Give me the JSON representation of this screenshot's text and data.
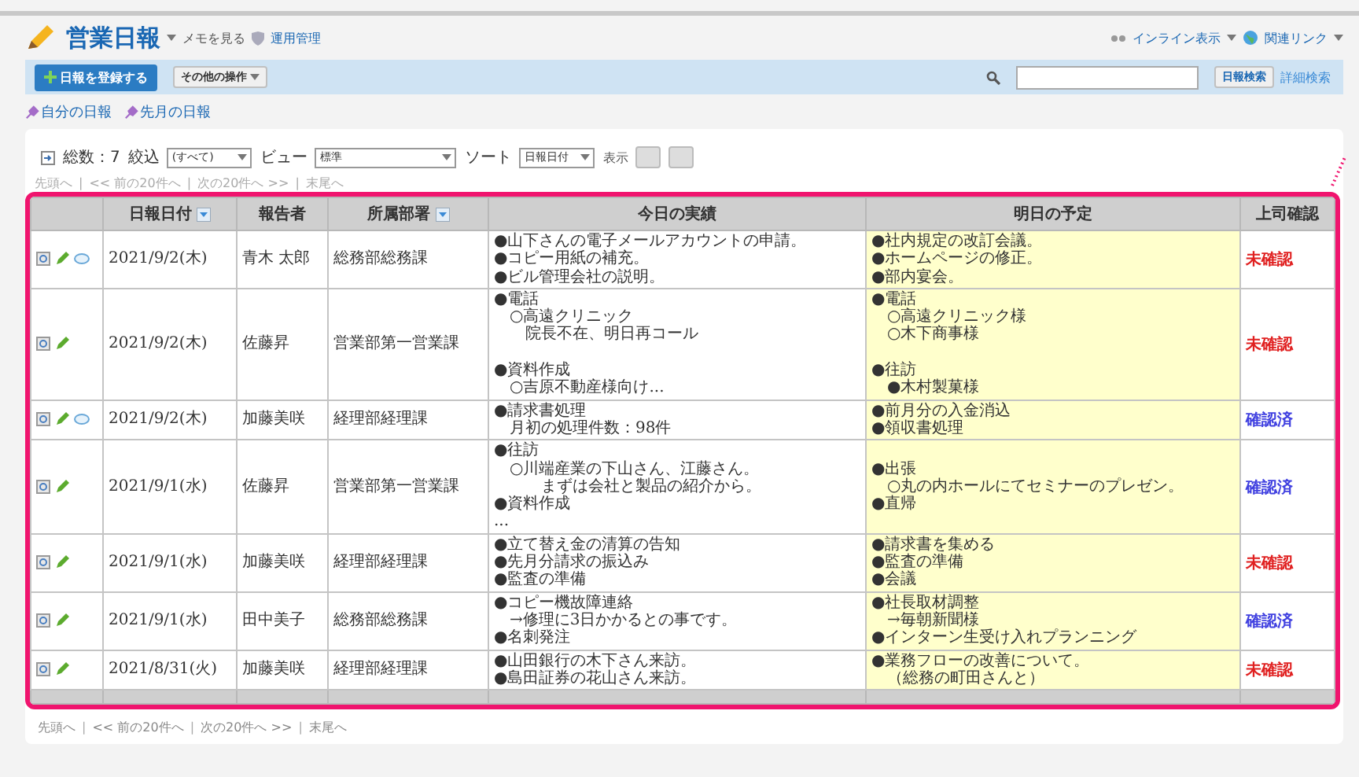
{
  "app": {
    "title": "営業日報",
    "memo_link": "メモを見る",
    "admin_link": "運用管理",
    "inline_view": "インライン表示",
    "related_links": "関連リンク"
  },
  "toolbar": {
    "register_button": "日報を登録する",
    "other_actions": "その他の操作",
    "search_button": "日報検索",
    "advanced_search": "詳細検索"
  },
  "favorites": [
    "自分の日報",
    "先月の日報"
  ],
  "filter_bar": {
    "total": "総数：7",
    "filter_label": "絞込",
    "filter_value": "(すべて)",
    "view_label": "ビュー",
    "view_value": "標準",
    "sort_label": "ソート",
    "sort_value": "日報日付",
    "display_label": "表示"
  },
  "top_pager": {
    "links": [
      "先頭へ",
      "<< 前の20件へ",
      "次の20件へ >>",
      "末尾へ"
    ],
    "separator": "|"
  },
  "table": {
    "columns": [
      {
        "label": "日報日付",
        "sortable": true
      },
      {
        "label": "報告者",
        "sortable": false
      },
      {
        "label": "所属部署",
        "sortable": true
      },
      {
        "label": "今日の実績",
        "sortable": false
      },
      {
        "label": "明日の予定",
        "sortable": false
      },
      {
        "label": "上司確認",
        "sortable": false
      }
    ],
    "rows": [
      {
        "has_comment": true,
        "date": "2021/9/2(木)",
        "reporter": "青木 太郎",
        "department": "総務部総務課",
        "today": [
          [
            "●山下さんの電子メールアカウントの申請。",
            "●コピー用紙の補充。",
            "●ビル管理会社の説明。"
          ]
        ],
        "tomorrow": [
          [
            "●社内規定の改訂会議。",
            "●ホームページの修正。",
            "●部内宴会。"
          ]
        ],
        "status": "未確認",
        "confirmed": false
      },
      {
        "has_comment": false,
        "date": "2021/9/2(木)",
        "reporter": "佐藤昇",
        "department": "営業部第一営業課",
        "today": [
          [
            "●電話",
            "　○高遠クリニック",
            "　　院長不在、明日再コール"
          ],
          [
            "●資料作成",
            "　○吉原不動産様向け..."
          ]
        ],
        "tomorrow": [
          [
            "●電話",
            "　○高遠クリニック様",
            "　○木下商事様"
          ],
          [
            "●往訪",
            "　●木村製菓様"
          ]
        ],
        "status": "未確認",
        "confirmed": false
      },
      {
        "has_comment": true,
        "date": "2021/9/2(木)",
        "reporter": "加藤美咲",
        "department": "経理部経理課",
        "today": [
          [
            "●請求書処理",
            "　月初の処理件数：98件"
          ]
        ],
        "tomorrow": [
          [
            "●前月分の入金消込",
            "●領収書処理"
          ]
        ],
        "status": "確認済",
        "confirmed": true
      },
      {
        "has_comment": false,
        "date": "2021/9/1(水)",
        "reporter": "佐藤昇",
        "department": "営業部第一営業課",
        "today": [
          [
            "●往訪",
            "　○川端産業の下山さん、江藤さん。",
            "　　　まずは会社と製品の紹介から。",
            "●資料作成",
            "..."
          ]
        ],
        "tomorrow": [
          [
            "●出張",
            "　○丸の内ホールにてセミナーのプレゼン。",
            "●直帰"
          ]
        ],
        "status": "確認済",
        "confirmed": true
      },
      {
        "has_comment": false,
        "date": "2021/9/1(水)",
        "reporter": "加藤美咲",
        "department": "経理部経理課",
        "today": [
          [
            "●立て替え金の清算の告知",
            "●先月分請求の振込み",
            "●監査の準備"
          ]
        ],
        "tomorrow": [
          [
            "●請求書を集める",
            "●監査の準備",
            "●会議"
          ]
        ],
        "status": "未確認",
        "confirmed": false
      },
      {
        "has_comment": false,
        "date": "2021/9/1(水)",
        "reporter": "田中美子",
        "department": "総務部総務課",
        "today": [
          [
            "●コピー機故障連絡",
            "　→修理に3日かかるとの事です。",
            "●名刺発注"
          ]
        ],
        "tomorrow": [
          [
            "●社長取材調整",
            "　→毎朝新聞様",
            "●インターン生受け入れプランニング"
          ]
        ],
        "status": "確認済",
        "confirmed": true
      },
      {
        "has_comment": false,
        "date": "2021/8/31(火)",
        "reporter": "加藤美咲",
        "department": "経理部経理課",
        "today": [
          [
            "●山田銀行の木下さん来訪。",
            "●島田証券の花山さん来訪。"
          ]
        ],
        "tomorrow": [
          [
            "●業務フローの改善について。",
            "　（総務の町田さんと）"
          ]
        ],
        "status": "未確認",
        "confirmed": false
      }
    ]
  },
  "bottom_pager": {
    "links": [
      "先頭へ",
      "<< 前の20件へ",
      "次の20件へ >>",
      "末尾へ"
    ],
    "separator": "|"
  }
}
